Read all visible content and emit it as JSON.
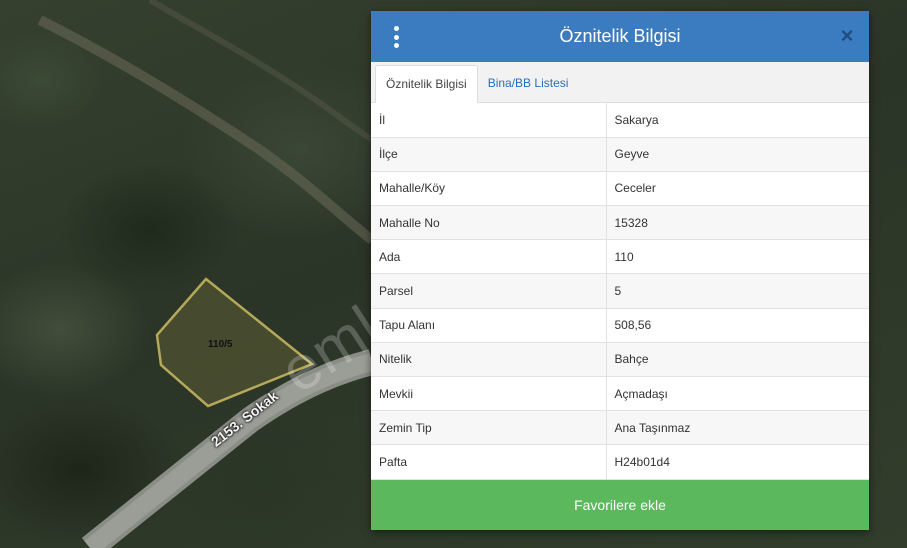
{
  "map": {
    "parcel_label": "110/5",
    "road_label": "2153. Sokak",
    "watermark": "emlakjet.com"
  },
  "panel": {
    "title": "Öznitelik Bilgisi",
    "menu_icon": "vertical-dots-icon",
    "close_icon": "close-icon",
    "close_symbol": "×",
    "header_color": "#3b7bbf",
    "tabs": [
      {
        "label": "Öznitelik Bilgisi",
        "active": true
      },
      {
        "label": "Bina/BB Listesi",
        "active": false
      }
    ],
    "rows": [
      {
        "key": "İl",
        "value": "Sakarya"
      },
      {
        "key": "İlçe",
        "value": "Geyve"
      },
      {
        "key": "Mahalle/Köy",
        "value": "Ceceler"
      },
      {
        "key": "Mahalle No",
        "value": "15328"
      },
      {
        "key": "Ada",
        "value": "110"
      },
      {
        "key": "Parsel",
        "value": "5"
      },
      {
        "key": "Tapu Alanı",
        "value": "508,56"
      },
      {
        "key": "Nitelik",
        "value": "Bahçe"
      },
      {
        "key": "Mevkii",
        "value": "Açmadaşı"
      },
      {
        "key": "Zemin Tip",
        "value": "Ana Taşınmaz"
      },
      {
        "key": "Pafta",
        "value": "H24b01d4"
      }
    ],
    "favorite_button": "Favorilere ekle",
    "favorite_color": "#5cb85c"
  }
}
